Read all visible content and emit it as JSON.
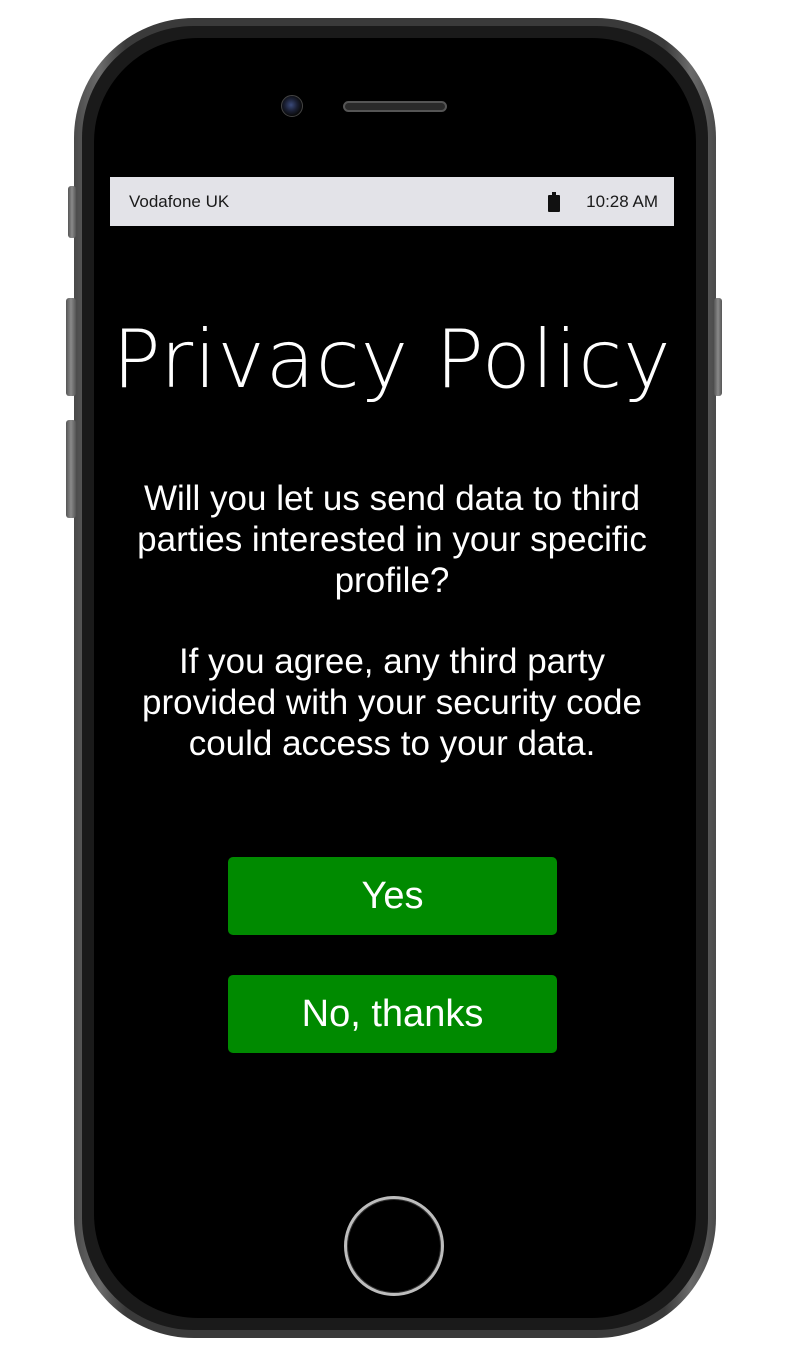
{
  "status_bar": {
    "carrier": "Vodafone UK",
    "battery_icon": "battery-icon",
    "time": "10:28 AM"
  },
  "screen": {
    "title": "Privacy Policy",
    "paragraph_1": "Will you let us send data to third parties interested in your specific profile?",
    "paragraph_2": "If you agree, any third party provided with your security code could access to your data."
  },
  "buttons": {
    "yes_label": "Yes",
    "no_label": "No, thanks"
  },
  "colors": {
    "screen_background": "#000000",
    "status_bar_background": "#e3e3e8",
    "button_background": "#008a00",
    "text": "#ffffff"
  }
}
